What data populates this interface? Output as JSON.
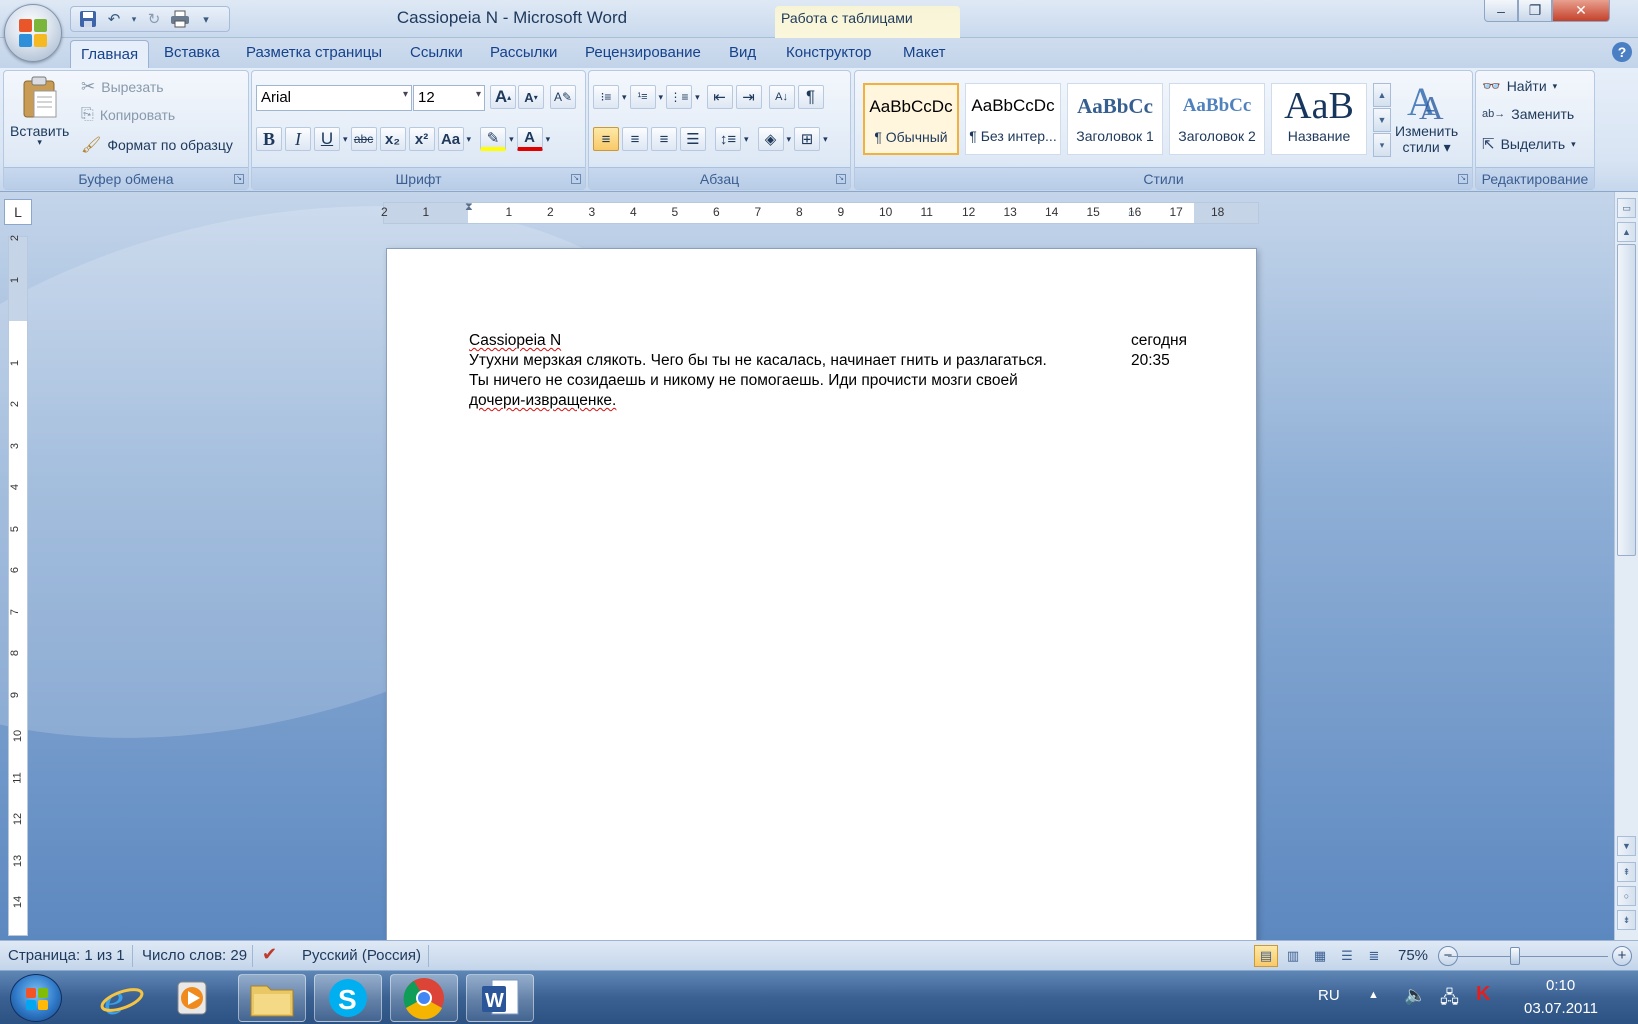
{
  "window": {
    "title": "Cassiopeia N - Microsoft Word",
    "context_tab_group": "Работа с таблицами"
  },
  "tabs": [
    "Главная",
    "Вставка",
    "Разметка страницы",
    "Ссылки",
    "Рассылки",
    "Рецензирование",
    "Вид",
    "Конструктор",
    "Макет"
  ],
  "active_tab": "Главная",
  "ribbon": {
    "clipboard": {
      "label": "Буфер обмена",
      "paste": "Вставить",
      "cut": "Вырезать",
      "copy": "Копировать",
      "format_painter": "Формат по образцу"
    },
    "font": {
      "label": "Шрифт",
      "font_name": "Arial",
      "font_size": "12",
      "bold": "B",
      "italic": "I",
      "underline": "U",
      "strike": "abc",
      "subscript": "x₂",
      "superscript": "x²",
      "case": "Aa",
      "grow": "A",
      "shrink": "A",
      "font_color": "A"
    },
    "paragraph": {
      "label": "Абзац",
      "show_marks": "¶"
    },
    "styles": {
      "label": "Стили",
      "items": [
        {
          "sample": "AaBbCcDc",
          "name": "¶ Обычный"
        },
        {
          "sample": "AaBbCcDc",
          "name": "¶ Без интер..."
        },
        {
          "sample": "AaBbCc",
          "name": "Заголовок 1"
        },
        {
          "sample": "AaBbCc",
          "name": "Заголовок 2"
        },
        {
          "sample": "AaB",
          "name": "Название"
        }
      ],
      "change_styles_line1": "Изменить",
      "change_styles_line2": "стили"
    },
    "editing": {
      "label": "Редактирование",
      "find": "Найти",
      "replace": "Заменить",
      "select": "Выделить"
    }
  },
  "ruler": {
    "corner": "L",
    "h_ticks": [
      "2",
      "1",
      "1",
      "2",
      "3",
      "4",
      "5",
      "6",
      "7",
      "8",
      "9",
      "10",
      "11",
      "12",
      "13",
      "14",
      "15",
      "16",
      "17",
      "18"
    ],
    "v_ticks": [
      "2",
      "1",
      "1",
      "2",
      "3",
      "4",
      "5",
      "6",
      "7",
      "8",
      "9",
      "10",
      "11",
      "12",
      "13",
      "14"
    ]
  },
  "document": {
    "author": "Cassiopeia N",
    "date": "сегодня",
    "time": "20:35",
    "lines": [
      "Утухни мерзкая слякоть. Чего бы ты не касалась, начинает гнить и разлагаться.",
      "Ты ничего не созидаешь и никому не помогаешь. Иди прочисти мозги своей",
      "дочери-извращенке."
    ]
  },
  "status": {
    "page": "Страница: 1 из 1",
    "words": "Число слов: 29",
    "language": "Русский (Россия)",
    "zoom": "75%"
  },
  "taskbar": {
    "lang": "RU",
    "time": "0:10",
    "date": "03.07.2011"
  },
  "colors": {
    "ribbon_text": "#1e395b",
    "accent_blue": "#15428b",
    "spell_error": "#d01010",
    "grammar_error": "#2a8b2a"
  }
}
